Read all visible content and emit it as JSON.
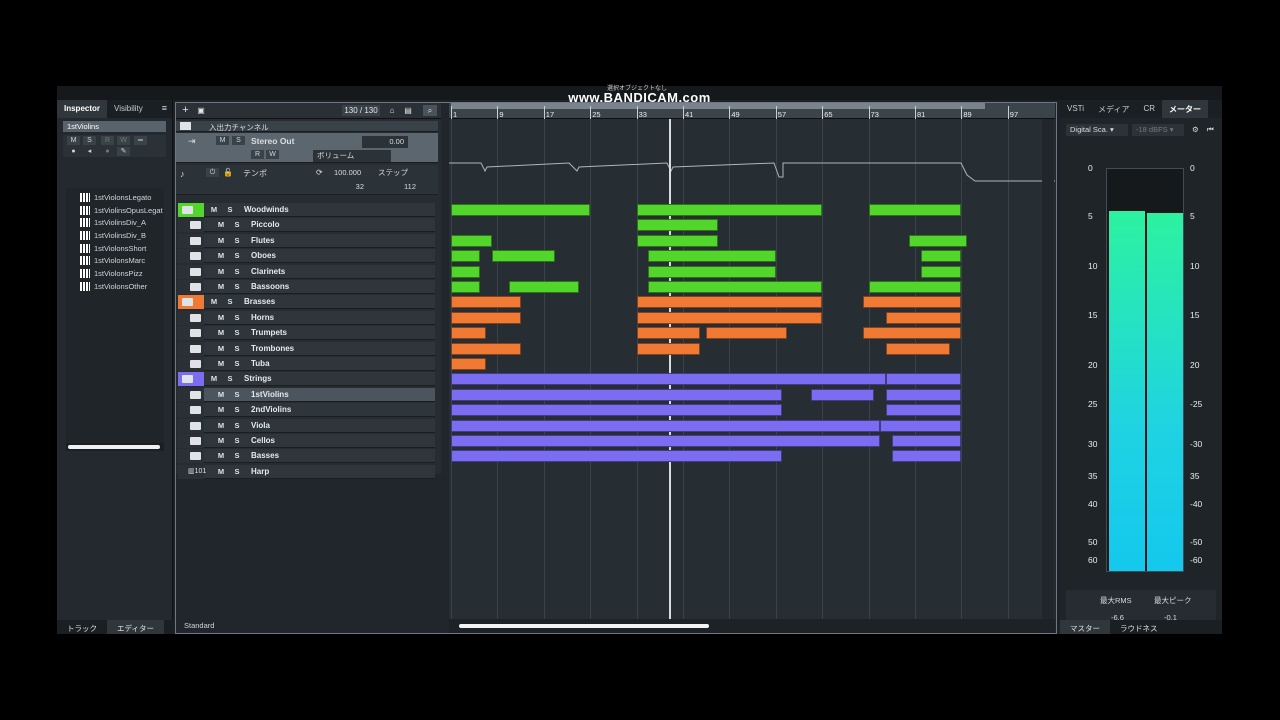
{
  "watermark": {
    "text": "www.BANDICAM.com",
    "subtext": "選択オブジェクトなし"
  },
  "inspector": {
    "tabs": [
      "Inspector",
      "Visibility"
    ],
    "menu_icon": "≡",
    "track_name": "1stViolins",
    "buttons": [
      "M",
      "S",
      "R",
      "W"
    ],
    "sub_tracks": [
      "1stViolonsLegato",
      "1stViolinsOpusLegat",
      "1stViolinsDiv_A",
      "1stViolinsDiv_B",
      "1stViolonsShort",
      "1stViolonsMarc",
      "1stViolonsPizz",
      "1stViolonsOther"
    ],
    "bottom_tabs": [
      "トラック",
      "エディター"
    ]
  },
  "toolbar": {
    "counter": "130 / 130",
    "add": "+"
  },
  "io_channel": {
    "title": "入出力チャンネル",
    "name": "Stereo Out",
    "m": "M",
    "s": "S",
    "r": "R",
    "w": "W",
    "volume": "0.00",
    "automation": "ボリューム"
  },
  "tempo": {
    "label": "テンポ",
    "value": "100.000",
    "mode": "ステップ",
    "sig_a": "32",
    "sig_b": "112"
  },
  "tracks": [
    {
      "name": "Woodwinds",
      "folder": true
    },
    {
      "name": "Piccolo"
    },
    {
      "name": "Flutes"
    },
    {
      "name": "Oboes"
    },
    {
      "name": "Clarinets"
    },
    {
      "name": "Bassoons"
    },
    {
      "name": "Brasses",
      "folder": true
    },
    {
      "name": "Horns"
    },
    {
      "name": "Trumpets"
    },
    {
      "name": "Trombones"
    },
    {
      "name": "Tuba"
    },
    {
      "name": "Strings",
      "folder": true
    },
    {
      "name": "1stViolins"
    },
    {
      "name": "2ndViolins"
    },
    {
      "name": "Viola"
    },
    {
      "name": "Cellos"
    },
    {
      "name": "Basses"
    },
    {
      "name": "Harp",
      "number": "101"
    }
  ],
  "track_buttons": {
    "m": "M",
    "s": "S"
  },
  "ruler": {
    "bars": [
      "1",
      "9",
      "17",
      "25",
      "33",
      "41",
      "49",
      "57",
      "65",
      "73",
      "81",
      "89",
      "97"
    ]
  },
  "footer": {
    "preset": "Standard"
  },
  "right_panel": {
    "tabs": [
      "VSTi",
      "メディア",
      "CR",
      "メーター"
    ],
    "meter_type": "Digital Sca.",
    "reference": "-18 dBFS",
    "scale": [
      "0",
      "5",
      "10",
      "15",
      "20",
      "25",
      "30",
      "35",
      "40",
      "50",
      "60"
    ],
    "scale_right": [
      "0",
      "5",
      "10",
      "15",
      "20",
      "-25",
      "-30",
      "35",
      "-40",
      "-50",
      "-60"
    ],
    "max_rms_label": "最大RMS",
    "max_peak_label": "最大ピーク",
    "max_rms": "-6.6",
    "max_peak": "-0.1",
    "levels_db": [
      -4.5,
      -4.7
    ],
    "bottom_tabs": [
      "マスター",
      "ラウドネス"
    ]
  },
  "colors": {
    "woodwinds": "#53d62b",
    "brasses": "#f07a33",
    "strings": "#7b6df2"
  }
}
